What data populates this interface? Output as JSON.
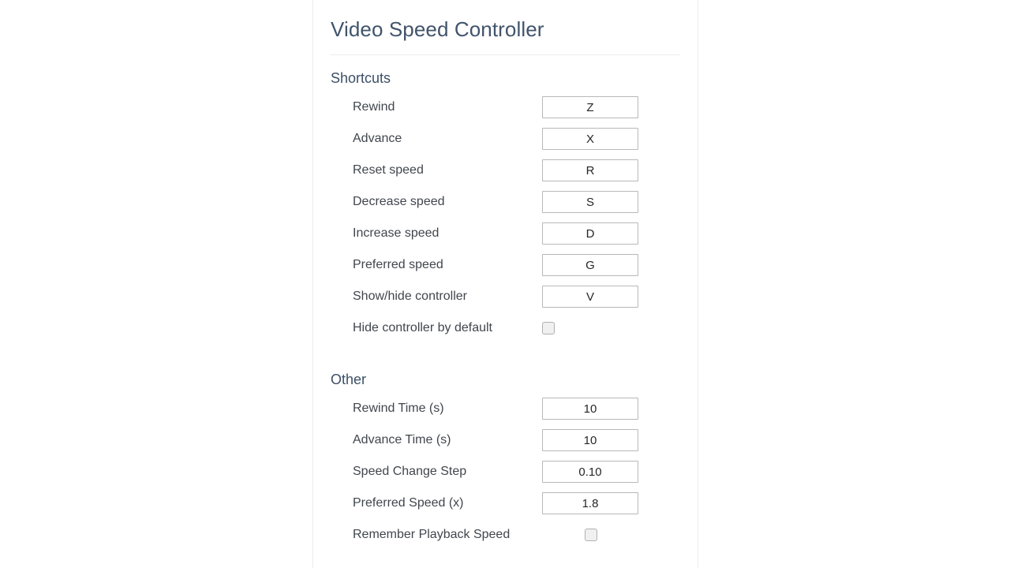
{
  "window": {
    "background_color": "#ffffff",
    "panel_border_color": "#ebebeb"
  },
  "header": {
    "title": "Video Speed Controller"
  },
  "sections": [
    {
      "id": "shortcuts",
      "heading": "Shortcuts",
      "rows": [
        {
          "label": "Rewind",
          "type": "text",
          "value": "Z"
        },
        {
          "label": "Advance",
          "type": "text",
          "value": "X"
        },
        {
          "label": "Reset speed",
          "type": "text",
          "value": "R"
        },
        {
          "label": "Decrease speed",
          "type": "text",
          "value": "S"
        },
        {
          "label": "Increase speed",
          "type": "text",
          "value": "D"
        },
        {
          "label": "Preferred speed",
          "type": "text",
          "value": "G"
        },
        {
          "label": "Show/hide controller",
          "type": "text",
          "value": "V"
        },
        {
          "label": "Hide controller by default",
          "type": "checkbox",
          "checked": false
        }
      ]
    },
    {
      "id": "other",
      "heading": "Other",
      "rows": [
        {
          "label": "Rewind Time (s)",
          "type": "text",
          "value": "10"
        },
        {
          "label": "Advance Time (s)",
          "type": "text",
          "value": "10"
        },
        {
          "label": "Speed Change Step",
          "type": "text",
          "value": "0.10"
        },
        {
          "label": "Preferred Speed (x)",
          "type": "text",
          "value": "1.8"
        },
        {
          "label": "Remember Playback Speed",
          "type": "checkbox",
          "checked": false
        }
      ]
    }
  ],
  "colors": {
    "title": "#41546b",
    "heading": "#3c4f66",
    "label": "#40464d",
    "field_border": "#b8b8b8",
    "field_text": "#262626",
    "checkbox_border": "#b0b0b0",
    "checkbox_fill": "#f0f0f0",
    "divider": "#ececec"
  }
}
